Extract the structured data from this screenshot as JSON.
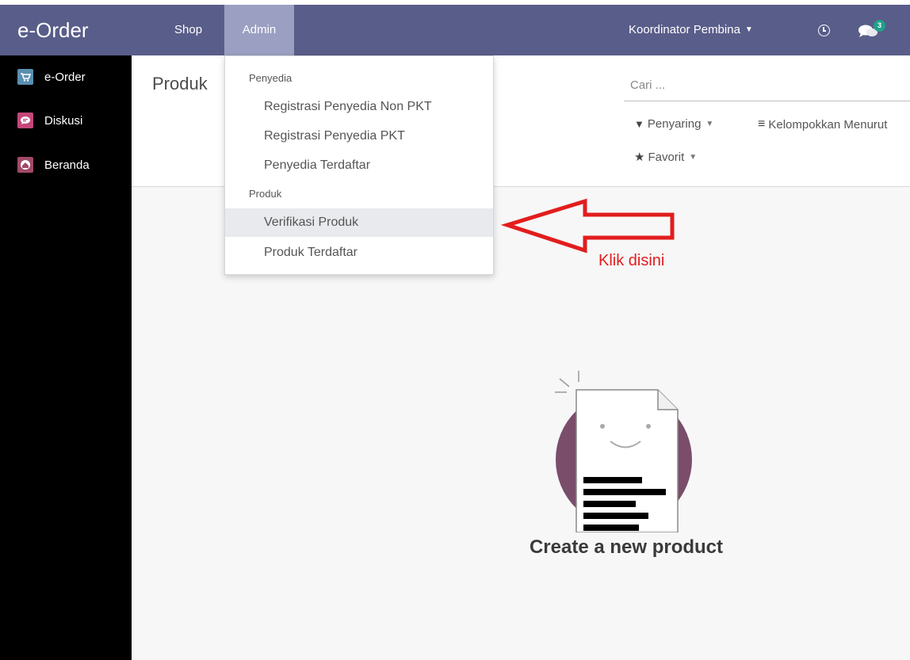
{
  "navbar": {
    "brand": "e-Order",
    "menu": [
      {
        "label": "Shop"
      },
      {
        "label": "Admin"
      }
    ],
    "user": "Koordinator Pembina",
    "message_count": "3"
  },
  "sidebar": {
    "items": [
      {
        "label": "e-Order",
        "icon": "cart-icon",
        "color": "#5a8fb0"
      },
      {
        "label": "Diskusi",
        "icon": "chat-bubble-icon",
        "color": "#c4477a"
      },
      {
        "label": "Beranda",
        "icon": "home-icon",
        "color": "#a04a68"
      }
    ]
  },
  "control_panel": {
    "breadcrumb": "Produk",
    "search_placeholder": "Cari ...",
    "filter_label": "Penyaring",
    "group_label": "Kelompokkan Menurut",
    "favorite_label": "Favorit"
  },
  "dropdown": {
    "sections": [
      {
        "header": "Penyedia",
        "items": [
          "Registrasi Penyedia Non PKT",
          "Registrasi Penyedia PKT",
          "Penyedia Terdaftar"
        ]
      },
      {
        "header": "Produk",
        "items": [
          "Verifikasi Produk",
          "Produk Terdaftar"
        ]
      }
    ]
  },
  "annotation": {
    "text": "Klik disini",
    "color": "#e21d1d"
  },
  "empty_state": {
    "title": "Create a new product"
  },
  "colors": {
    "navbar": "#595d89",
    "navbar_active": "#9b9fc1",
    "sidebar": "#000000",
    "badge": "#21a08b",
    "illustration_circle": "#7a4d6b"
  }
}
